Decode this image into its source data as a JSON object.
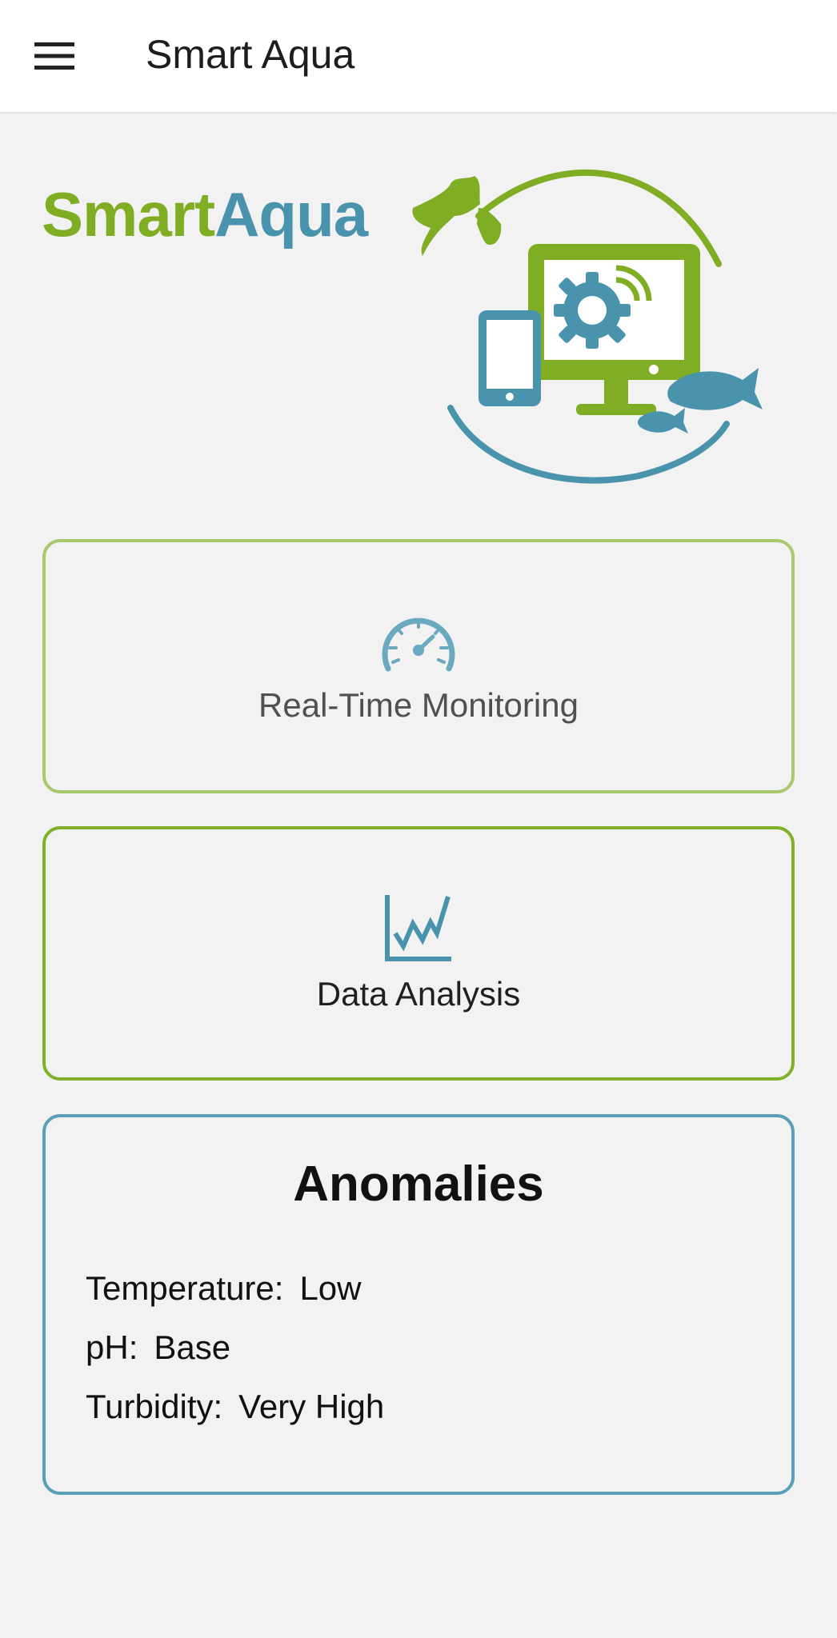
{
  "app_bar": {
    "title": "Smart Aqua",
    "menu_icon": "hamburger-menu-icon"
  },
  "brand": {
    "part1": "Smart",
    "part2": "Aqua",
    "colors": {
      "green": "#7fad24",
      "blue": "#4993ad"
    }
  },
  "logo": {
    "icons": [
      "leaf-icon",
      "monitor-icon",
      "gear-icon",
      "wifi-icon",
      "smartphone-icon",
      "fish-icon"
    ]
  },
  "cards": {
    "monitoring": {
      "label": "Real-Time Monitoring",
      "icon": "speedometer-icon",
      "border_color": "#a9c96c"
    },
    "analysis": {
      "label": "Data Analysis",
      "icon": "line-chart-icon",
      "border_color": "#7fb029"
    }
  },
  "anomalies": {
    "title": "Anomalies",
    "border_color": "#5a9fb7",
    "items": [
      {
        "label": "Temperature:",
        "value": "Low"
      },
      {
        "label": "pH:",
        "value": "Base"
      },
      {
        "label": "Turbidity:",
        "value": "Very High"
      }
    ]
  }
}
